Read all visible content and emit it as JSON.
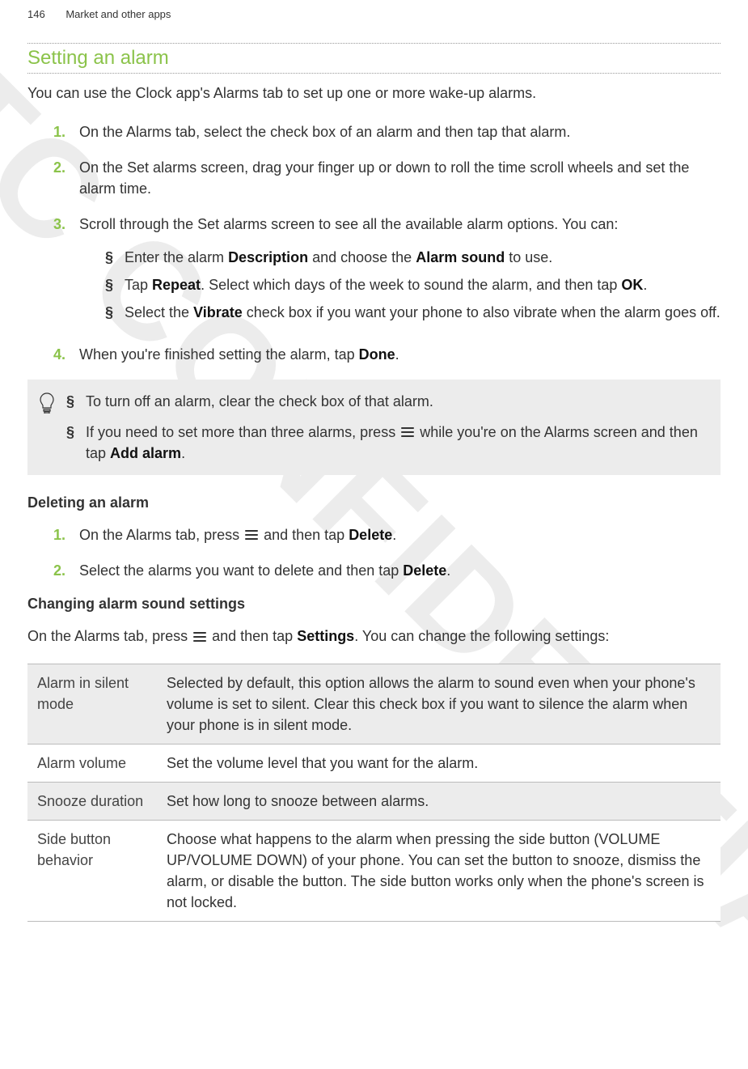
{
  "header": {
    "page_number": "146",
    "section": "Market and other apps"
  },
  "watermark": "HTC CONFIDENTIAL",
  "setting_alarm": {
    "title": "Setting an alarm",
    "intro": "You can use the Clock app's Alarms tab to set up one or more wake-up alarms.",
    "steps": {
      "1": "On the Alarms tab, select the check box of an alarm and then tap that alarm.",
      "2": "On the Set alarms screen, drag your finger up or down to roll the time scroll wheels and set the alarm time.",
      "3": "Scroll through the Set alarms screen to see all the available alarm options. You can:",
      "3_bullets": {
        "a_pre": "Enter the alarm ",
        "a_b1": "Description",
        "a_mid": " and choose the ",
        "a_b2": "Alarm sound",
        "a_post": " to use.",
        "b_pre": "Tap ",
        "b_b1": "Repeat",
        "b_mid": ". Select which days of the week to sound the alarm, and then tap ",
        "b_b2": "OK",
        "b_post": ".",
        "c_pre": "Select the ",
        "c_b1": "Vibrate",
        "c_post": " check box if you want your phone to also vibrate when the alarm goes off."
      },
      "4_pre": "When you're finished setting the alarm, tap ",
      "4_b1": "Done",
      "4_post": "."
    },
    "tip": {
      "b1": "To turn off an alarm, clear the check box of that alarm.",
      "b2_pre": "If you need to set more than three alarms, press ",
      "b2_mid": " while you're on the Alarms screen and then tap ",
      "b2_b1": "Add alarm",
      "b2_post": "."
    }
  },
  "deleting_alarm": {
    "title": "Deleting an alarm",
    "steps": {
      "1_pre": "On the Alarms tab, press ",
      "1_mid": " and then tap ",
      "1_b1": "Delete",
      "1_post": ".",
      "2_pre": "Select the alarms you want to delete and then tap ",
      "2_b1": "Delete",
      "2_post": "."
    }
  },
  "changing_settings": {
    "title": "Changing alarm sound settings",
    "intro_pre": "On the Alarms tab, press ",
    "intro_mid": " and then tap ",
    "intro_b1": "Settings",
    "intro_post": ". You can change the following settings:",
    "table": [
      {
        "label": "Alarm in silent mode",
        "desc": "Selected by default, this option allows the alarm to sound even when your phone's volume is set to silent. Clear this check box if you want to silence the alarm when your phone is in silent mode."
      },
      {
        "label": "Alarm volume",
        "desc": "Set the volume level that you want for the alarm."
      },
      {
        "label": "Snooze duration",
        "desc": "Set how long to snooze between alarms."
      },
      {
        "label": "Side button behavior",
        "desc": "Choose what happens to the alarm when pressing the side button (VOLUME UP/VOLUME DOWN) of your phone. You can set the button to snooze, dismiss the alarm, or disable the button. The side button works only when the phone's screen is not locked."
      }
    ]
  }
}
